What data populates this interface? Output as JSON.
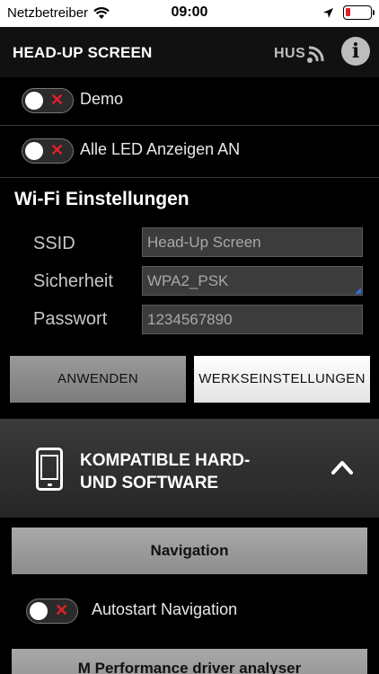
{
  "statusbar": {
    "carrier": "Netzbetreiber",
    "time": "09:00",
    "battery_level": 0.18,
    "battery_color": "#e0202a"
  },
  "header": {
    "title": "HEAD-UP SCREEN",
    "hus_label": "HUS",
    "info_glyph": "i"
  },
  "toggles": {
    "demo": {
      "label": "Demo",
      "on": false
    },
    "led": {
      "label": "Alle LED Anzeigen AN",
      "on": false
    }
  },
  "wifi": {
    "title": "Wi-Fi Einstellungen",
    "ssid": {
      "label": "SSID",
      "value": "Head-Up Screen"
    },
    "security": {
      "label": "Sicherheit",
      "value": "WPA2_PSK"
    },
    "password": {
      "label": "Passwort",
      "value": "1234567890"
    },
    "apply_label": "ANWENDEN",
    "reset_label": "WERKSEINSTELLUNGEN"
  },
  "compat": {
    "title_line1": "KOMPATIBLE HARD-",
    "title_line2": "UND SOFTWARE",
    "icon": "smartphone-icon",
    "expand_icon": "chevron-up-icon"
  },
  "navigation": {
    "button_label": "Navigation",
    "autostart": {
      "label": "Autostart Navigation",
      "on": false
    }
  },
  "mperformance": {
    "button_label": "M Performance driver analyser"
  },
  "colors": {
    "accent_red": "#e0202a",
    "background": "#000000",
    "header_bg": "#111111",
    "field_bg": "#3c3c3c"
  }
}
